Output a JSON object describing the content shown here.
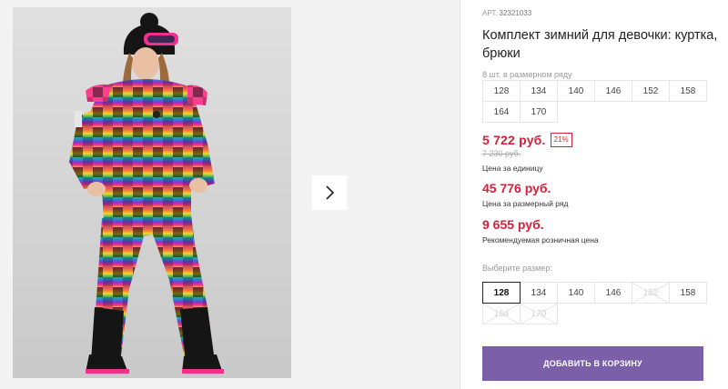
{
  "product": {
    "sku_label": "АРТ.",
    "sku_value": "32321033",
    "title": "Комплект зимний для девочки: куртка, брюки",
    "size_row_note": "8 шт. в размерном ряду",
    "size_row": [
      "128",
      "134",
      "140",
      "146",
      "152",
      "158",
      "164",
      "170"
    ]
  },
  "pricing": {
    "unit_price": "5 722 руб.",
    "discount_badge": "21%",
    "old_price": "7 230 руб.",
    "unit_label": "Цена за единицу",
    "row_price": "45 776 руб.",
    "row_label": "Цена за размерный ряд",
    "rrp_price": "9 655 руб.",
    "rrp_label": "Рекомендуемая розничная цена"
  },
  "size_picker": {
    "label": "Выберите размер:",
    "selected": "128",
    "sizes": [
      {
        "value": "128",
        "state": "selected"
      },
      {
        "value": "134",
        "state": "available"
      },
      {
        "value": "140",
        "state": "available"
      },
      {
        "value": "146",
        "state": "available"
      },
      {
        "value": "152",
        "state": "disabled"
      },
      {
        "value": "158",
        "state": "available"
      },
      {
        "value": "164",
        "state": "disabled"
      },
      {
        "value": "170",
        "state": "disabled"
      }
    ]
  },
  "actions": {
    "add_to_cart": "ДОБАВИТЬ В КОРЗИНУ",
    "next_icon": "chevron-right-icon"
  },
  "colors": {
    "price_red": "#d4203a",
    "button_purple": "#7c5fa9",
    "gallery_bg": "#f3f3f3"
  }
}
